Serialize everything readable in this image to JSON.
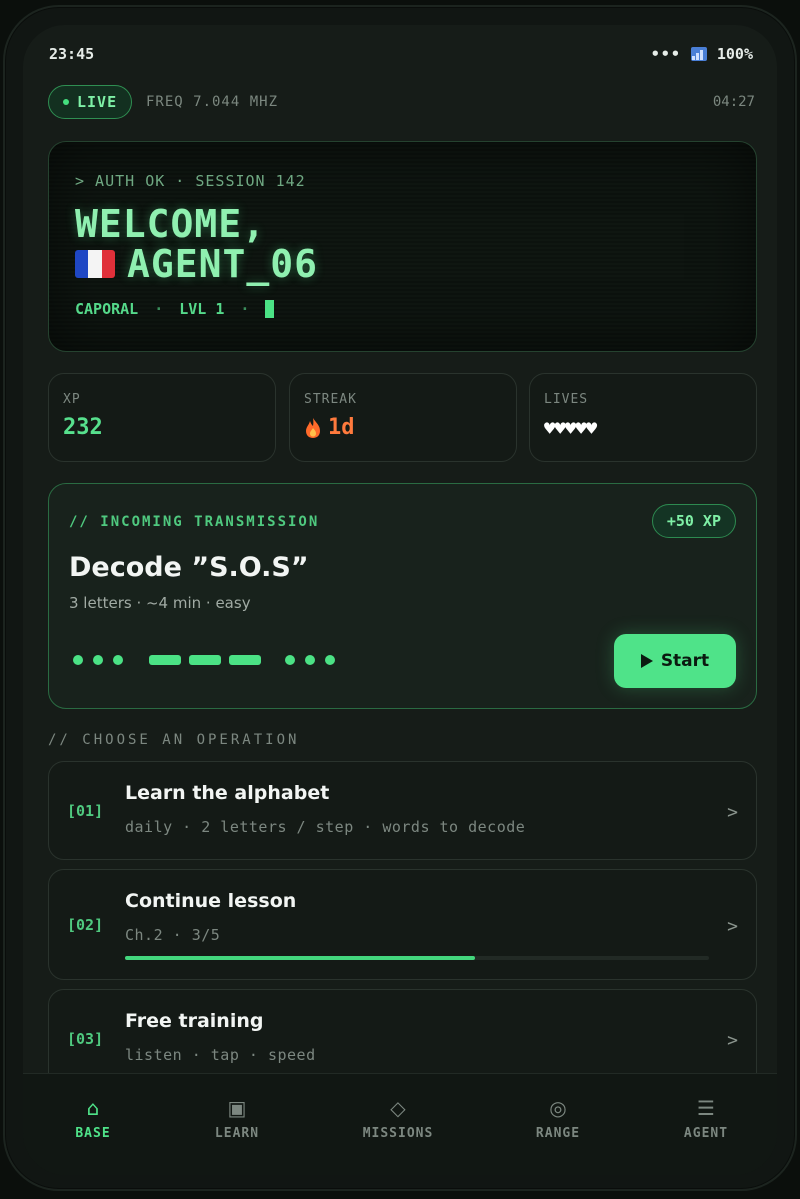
{
  "status": {
    "time": "23:45",
    "more": "•••",
    "battery": "100%"
  },
  "live": {
    "label": "LIVE",
    "freq": "FREQ 7.044 MHZ",
    "clock": "04:27"
  },
  "welcome": {
    "auth": "> AUTH OK · SESSION 142",
    "line1": "WELCOME,",
    "agent": "AGENT_06",
    "rank": "CAPORAL",
    "level": "LVL 1",
    "dot": "·"
  },
  "stats": {
    "xp": {
      "label": "XP",
      "value": "232"
    },
    "streak": {
      "label": "STREAK",
      "value": "1d"
    },
    "lives": {
      "label": "LIVES",
      "value": "♥♥♥♥♥"
    }
  },
  "transmission": {
    "title": "// INCOMING TRANSMISSION",
    "xp_badge": "+50 XP",
    "heading": "Decode ”S.O.S”",
    "meta": "3 letters · ~4 min · easy",
    "start_label": "Start"
  },
  "section_label": "// CHOOSE AN OPERATION",
  "operations": [
    {
      "num": "[01]",
      "title": "Learn the alphabet",
      "sub": "daily · 2 letters / step · words to decode"
    },
    {
      "num": "[02]",
      "title": "Continue lesson",
      "sub": "Ch.2 · 3/5",
      "progress": 0.6
    },
    {
      "num": "[03]",
      "title": "Free training",
      "sub": "listen · tap · speed"
    }
  ],
  "chevron": ">",
  "nav": [
    {
      "label": "BASE",
      "icon": "⌂"
    },
    {
      "label": "LEARN",
      "icon": "▣"
    },
    {
      "label": "MISSIONS",
      "icon": "◇"
    },
    {
      "label": "RANGE",
      "icon": "◎"
    },
    {
      "label": "AGENT",
      "icon": "☰"
    }
  ],
  "colors": {
    "accent": "#4fe389",
    "streak": "#ff7a3d",
    "bg": "#161c18"
  }
}
